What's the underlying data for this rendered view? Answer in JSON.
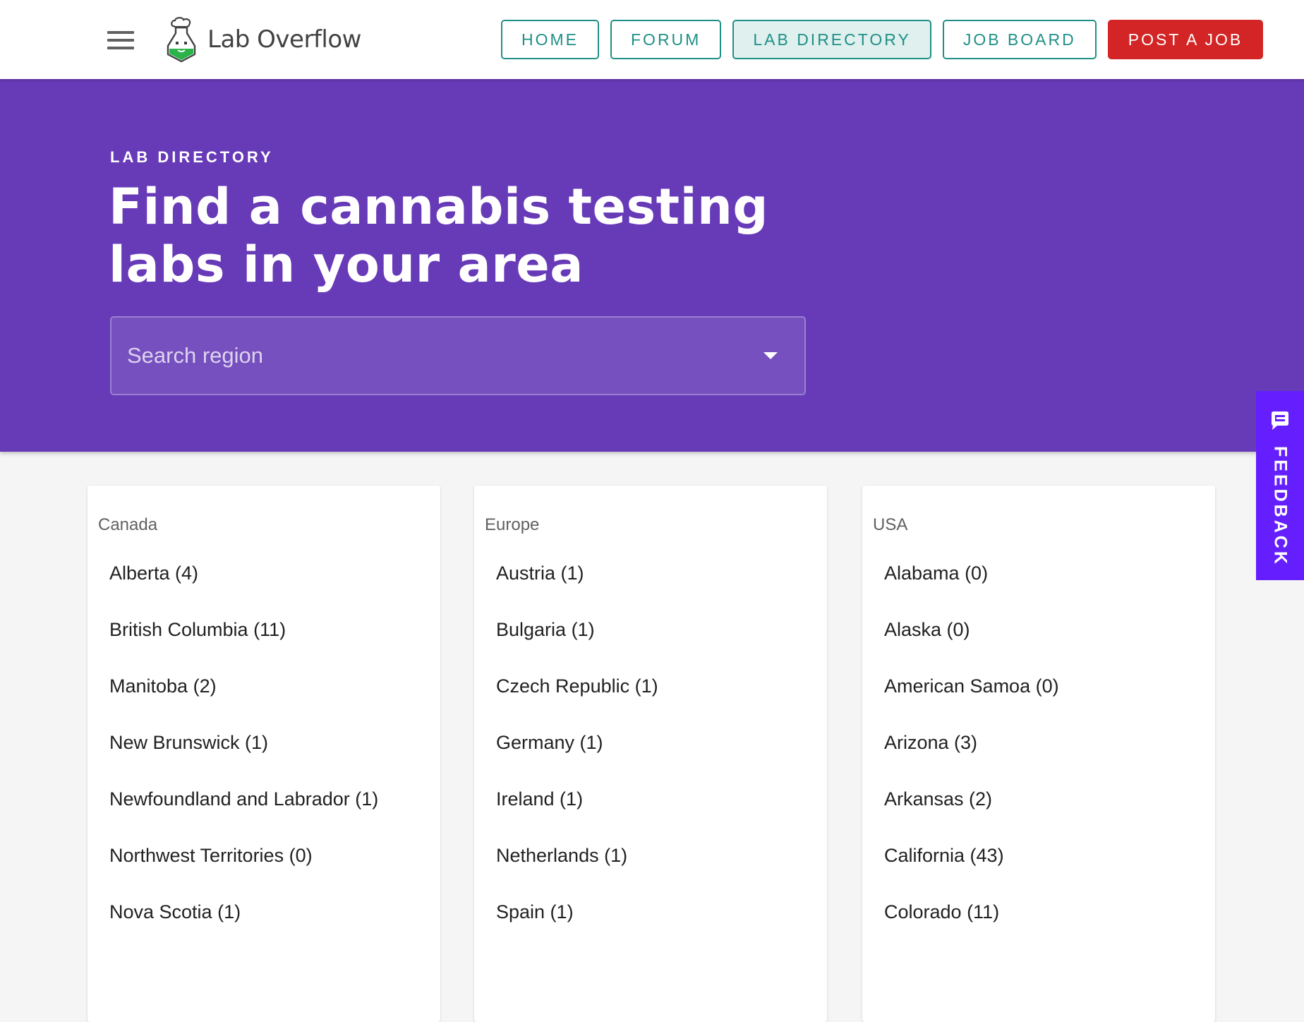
{
  "header": {
    "logo_text": "Lab Overflow",
    "nav": [
      {
        "label": "HOME"
      },
      {
        "label": "FORUM"
      },
      {
        "label": "LAB DIRECTORY"
      },
      {
        "label": "JOB BOARD"
      }
    ],
    "post_job_label": "POST A JOB",
    "accent_color": "#1f9087",
    "cta_color": "#d32525"
  },
  "hero": {
    "overline": "LAB DIRECTORY",
    "title": "Find a cannabis testing labs in your area",
    "search_placeholder": "Search region",
    "background_color": "#673ab7"
  },
  "feedback": {
    "label": "FEEDBACK",
    "color": "#651fff"
  },
  "regions": [
    {
      "title": "Canada",
      "items": [
        "Alberta (4)",
        "British Columbia (11)",
        "Manitoba (2)",
        "New Brunswick (1)",
        "Newfoundland and Labrador (1)",
        "Northwest Territories (0)",
        "Nova Scotia (1)"
      ]
    },
    {
      "title": "Europe",
      "items": [
        "Austria (1)",
        "Bulgaria (1)",
        "Czech Republic (1)",
        "Germany (1)",
        "Ireland (1)",
        "Netherlands (1)",
        "Spain (1)"
      ]
    },
    {
      "title": "USA",
      "items": [
        "Alabama (0)",
        "Alaska (0)",
        "American Samoa (0)",
        "Arizona (3)",
        "Arkansas (2)",
        "California (43)",
        "Colorado (11)"
      ]
    }
  ]
}
